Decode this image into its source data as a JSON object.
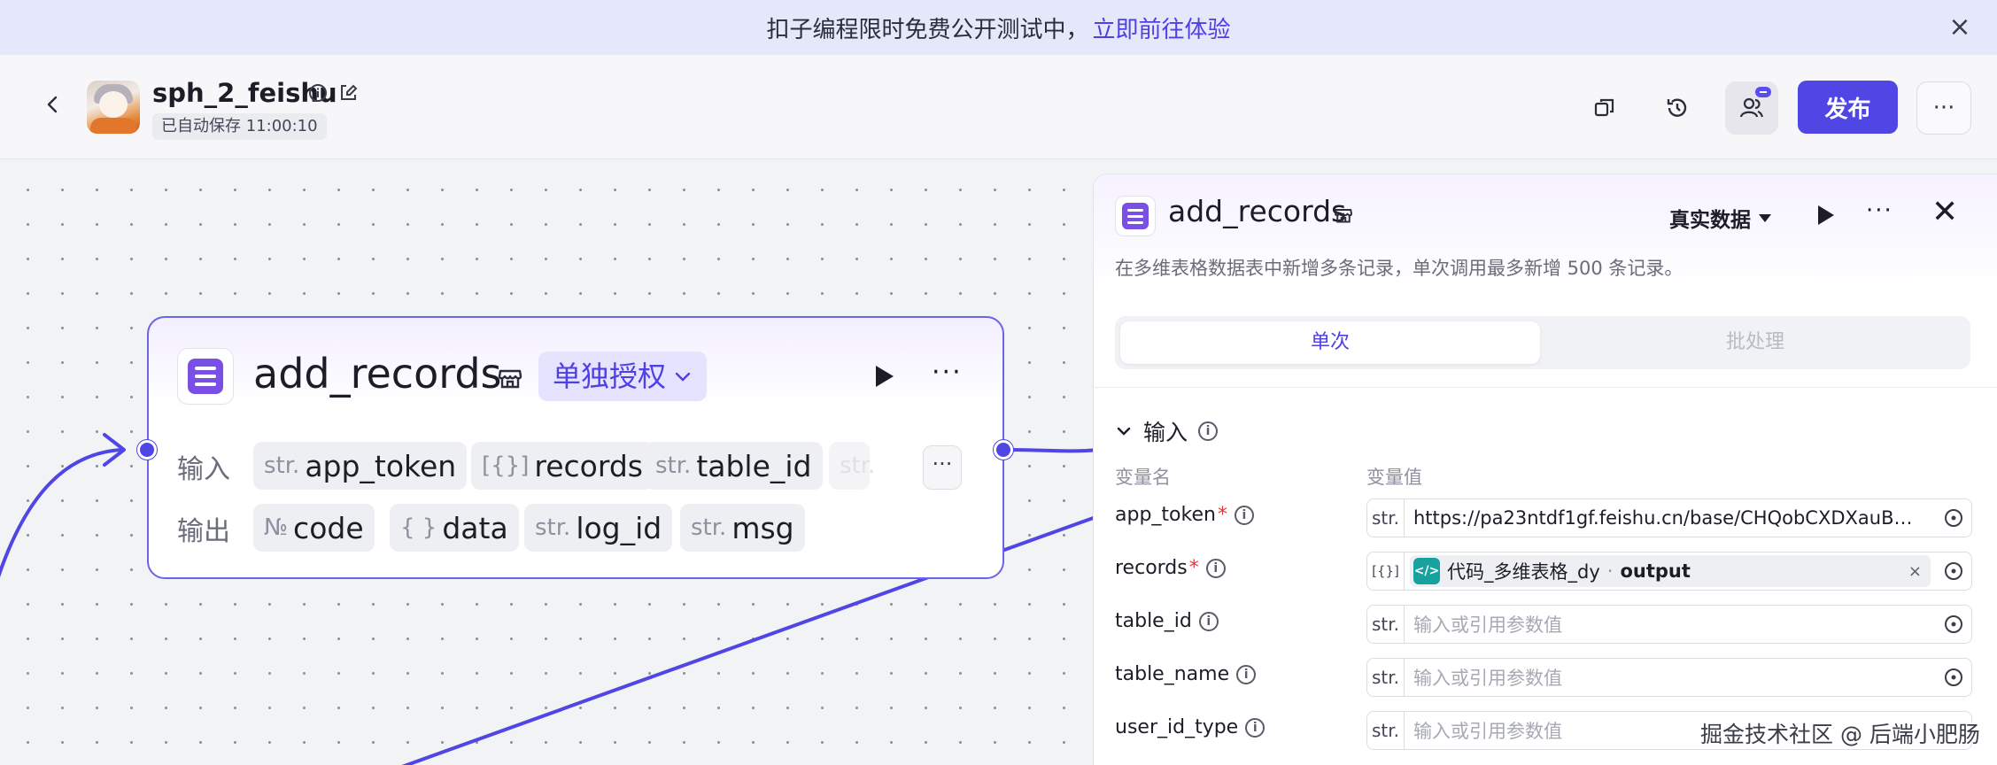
{
  "banner": {
    "text": "扣子编程限时免费公开测试中，",
    "link": "立即前往体验"
  },
  "header": {
    "title": "sph_2_feishu",
    "autosave": "已自动保存 11:00:10",
    "publish_label": "发布"
  },
  "node": {
    "title": "add_records",
    "auth_label": "单独授权",
    "input_label": "输入",
    "output_label": "输出",
    "inputs": [
      {
        "type": "str.",
        "name": "app_token"
      },
      {
        "type": "[{}]",
        "name": "records"
      },
      {
        "type": "str.",
        "name": "table_id"
      },
      {
        "type": "str.",
        "name": ""
      }
    ],
    "outputs": [
      {
        "type": "№",
        "name": "code"
      },
      {
        "type": "{ }",
        "name": "data"
      },
      {
        "type": "str.",
        "name": "log_id"
      },
      {
        "type": "str.",
        "name": "msg"
      }
    ]
  },
  "panel": {
    "title": "add_records",
    "mode": "真实数据",
    "description": "在多维表格数据表中新增多条记录，单次调用最多新增 500 条记录。",
    "tabs": [
      "单次",
      "批处理"
    ],
    "section_title": "输入",
    "col_name": "变量名",
    "col_value": "变量值",
    "fields": [
      {
        "name": "app_token",
        "required": "*",
        "type": "str.",
        "value": "https://pa23ntdf1gf.feishu.cn/base/CHQobCXDXauB…",
        "placeholder": ""
      },
      {
        "name": "records",
        "required": "*",
        "type": "[{}]",
        "ref_source": "代码_多维表格_dy",
        "ref_sep": "·",
        "ref_field": "output"
      },
      {
        "name": "table_id",
        "required": "",
        "type": "str.",
        "value": "",
        "placeholder": "输入或引用参数值"
      },
      {
        "name": "table_name",
        "required": "",
        "type": "str.",
        "value": "",
        "placeholder": "输入或引用参数值"
      },
      {
        "name": "user_id_type",
        "required": "",
        "type": "str.",
        "value": "",
        "placeholder": "输入或引用参数值"
      }
    ]
  },
  "watermark": "掘金技术社区 @ 后端小肥肠",
  "colors": {
    "accent": "#4f46e5",
    "banner_bg": "#e5e7fa",
    "edge": "#4f46e5",
    "required": "#e03a3a",
    "node_icon": "#7a4fe6"
  }
}
